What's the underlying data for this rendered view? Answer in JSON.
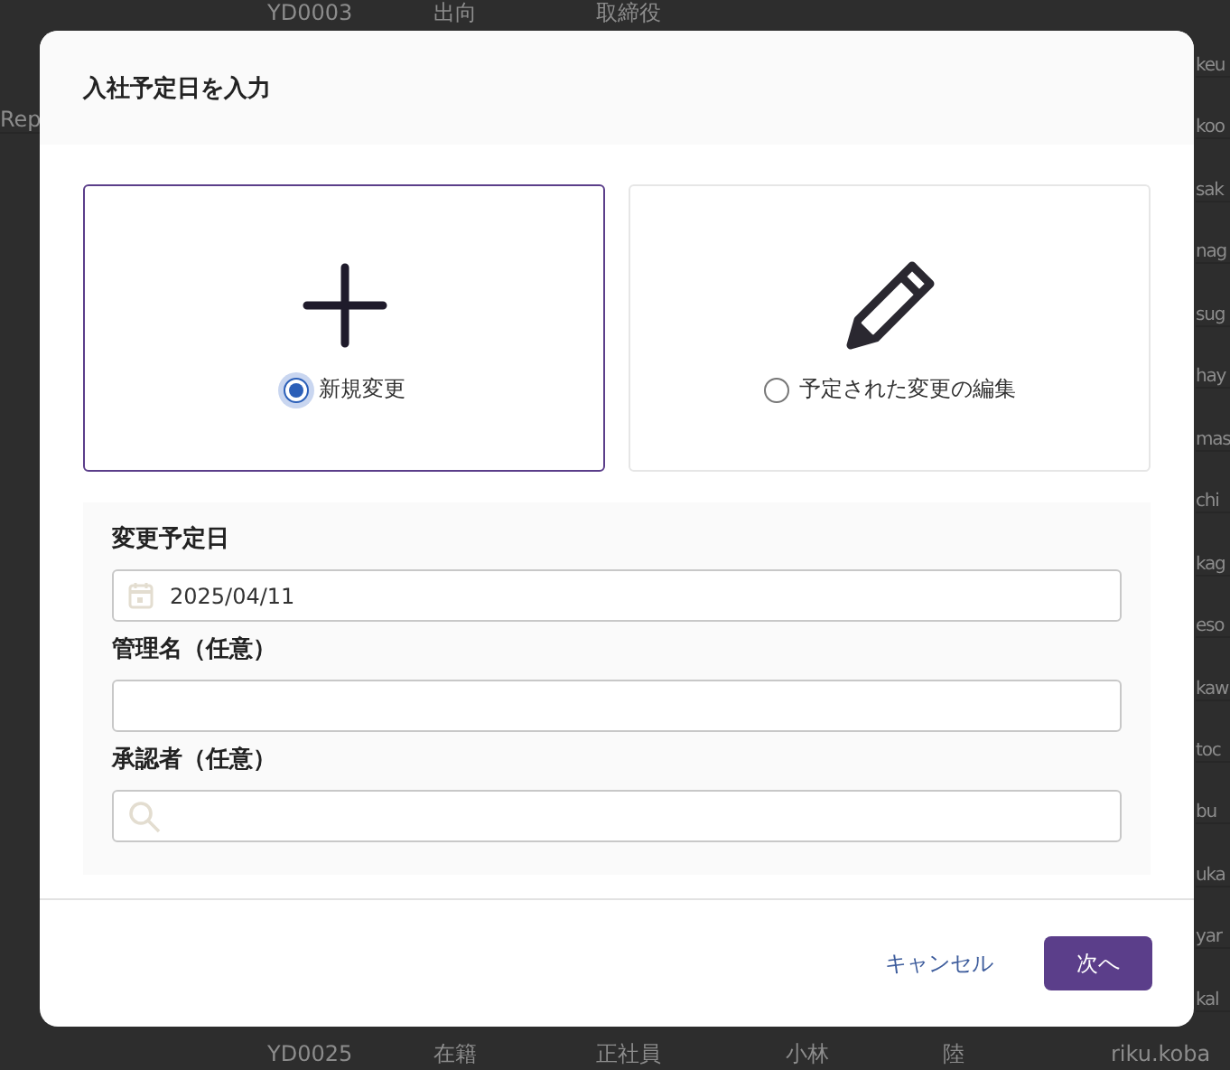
{
  "background_table": {
    "top_row": [
      "YD0003",
      "出向",
      "取締役"
    ],
    "left_column": [
      "Rep"
    ],
    "right_column": [
      "keu",
      "koo",
      "sak",
      "nag",
      "sug",
      "hay",
      "mas",
      "chi",
      "kag",
      "eso",
      "kaw",
      "toc",
      "bu",
      "uka",
      "yar",
      "kal"
    ],
    "bottom_row": [
      "YD0025",
      "在籍",
      "正社員",
      "小林",
      "陸",
      "riku.koba"
    ]
  },
  "dialog": {
    "title": "入社予定日を入力",
    "options": [
      {
        "label": "新規変更",
        "kind": "plus",
        "selected": true
      },
      {
        "label": "予定された変更の編集",
        "kind": "pencil",
        "selected": false
      }
    ],
    "fields": [
      {
        "label": "変更予定日",
        "kind": "date",
        "value": "2025/04/11"
      },
      {
        "label": "管理名（任意）",
        "kind": "text"
      },
      {
        "label": "承認者（任意）",
        "kind": "search"
      }
    ],
    "buttons": [
      {
        "label": "キャンセル",
        "kind": "link"
      },
      {
        "label": "次へ",
        "kind": "primary"
      }
    ]
  }
}
